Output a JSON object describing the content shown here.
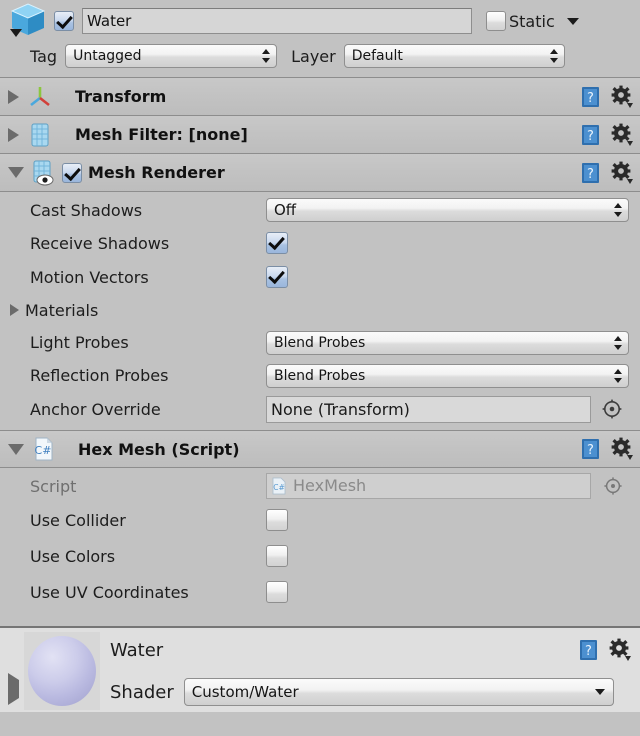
{
  "gameobject": {
    "icon_name": "cube-prefab-icon",
    "active_checkbox": true,
    "name": "Water",
    "static_label": "Static",
    "static_checked": false,
    "static_dropdown_icon": "chevron-down-icon",
    "tag_label": "Tag",
    "tag_value": "Untagged",
    "layer_label": "Layer",
    "layer_value": "Default"
  },
  "components": [
    {
      "name": "transform",
      "title": "Transform",
      "icon": "transform-axis-icon",
      "expanded": false,
      "has_enable_checkbox": false
    },
    {
      "name": "mesh-filter",
      "title": "Mesh Filter: [none]",
      "icon": "mesh-filter-icon",
      "expanded": false,
      "has_enable_checkbox": false
    },
    {
      "name": "mesh-renderer",
      "title": "Mesh Renderer",
      "icon": "mesh-renderer-icon",
      "expanded": true,
      "has_enable_checkbox": true,
      "enabled": true
    }
  ],
  "mesh_renderer": {
    "cast_shadows": {
      "label": "Cast Shadows",
      "value": "Off"
    },
    "receive_shadows": {
      "label": "Receive Shadows",
      "checked": true
    },
    "motion_vectors": {
      "label": "Motion Vectors",
      "checked": true
    },
    "materials": {
      "label": "Materials",
      "expanded": false
    },
    "light_probes": {
      "label": "Light Probes",
      "value": "Blend Probes"
    },
    "reflection_probes": {
      "label": "Reflection Probes",
      "value": "Blend Probes"
    },
    "anchor_override": {
      "label": "Anchor Override",
      "value": "None (Transform)",
      "picker_icon": "target-picker-icon"
    }
  },
  "hex_mesh": {
    "title": "Hex Mesh (Script)",
    "icon": "csharp-script-icon",
    "expanded": true,
    "script": {
      "label": "Script",
      "value": "HexMesh",
      "icon": "csharp-script-icon",
      "picker_icon": "target-picker-icon",
      "disabled": true
    },
    "use_collider": {
      "label": "Use Collider",
      "checked": false
    },
    "use_colors": {
      "label": "Use Colors",
      "checked": false
    },
    "use_uv_coordinates": {
      "label": "Use UV Coordinates",
      "checked": false
    }
  },
  "material": {
    "title": "Water",
    "preview_icon": "material-sphere-preview",
    "shader_label": "Shader",
    "shader_value": "Custom/Water",
    "expanded": false
  },
  "icons": {
    "help": "help-book-icon",
    "gear": "gear-settings-icon"
  },
  "colors": {
    "background": "#c2c2c2",
    "header_border": "#8d8d8d",
    "accent_blue": "#5c9fd8",
    "material_sphere": "#c0c0e4"
  }
}
